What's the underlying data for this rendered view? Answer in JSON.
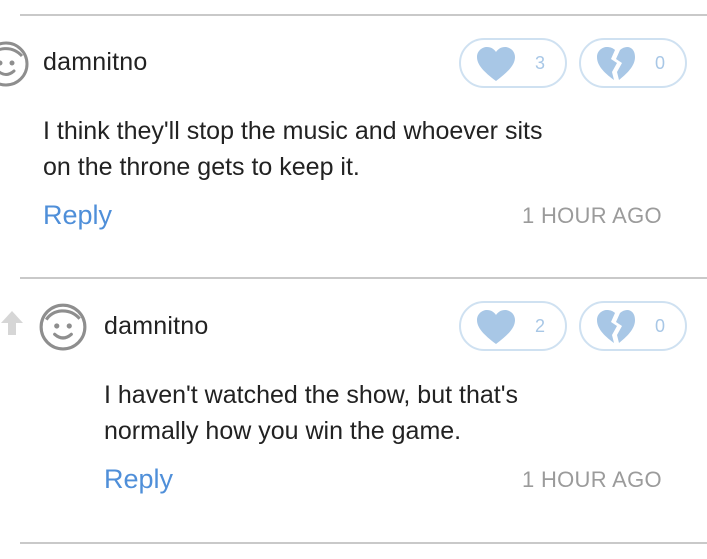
{
  "comments": [
    {
      "username": "damnitno",
      "likes": "3",
      "dislikes": "0",
      "text_lines": [
        "I think they'll stop the music and whoever sits",
        "on the throne gets to keep it."
      ],
      "reply_label": "Reply",
      "time": "1 HOUR AGO"
    },
    {
      "username": "damnitno",
      "likes": "2",
      "dislikes": "0",
      "text_lines": [
        "I haven't watched the show, but that's",
        "normally how you win the game."
      ],
      "reply_label": "Reply",
      "time": "1 HOUR AGO"
    }
  ],
  "colors": {
    "accent": "#4f8fd9",
    "pill_border": "#cfe1f1",
    "icon_fill": "#a8c7e6",
    "divider": "#c9c9c9",
    "muted": "#9b9b9b"
  },
  "icons": {
    "avatar": "smiley-face-icon",
    "like": "heart-icon",
    "dislike": "broken-heart-icon",
    "reply_indicator": "up-arrow-icon"
  }
}
